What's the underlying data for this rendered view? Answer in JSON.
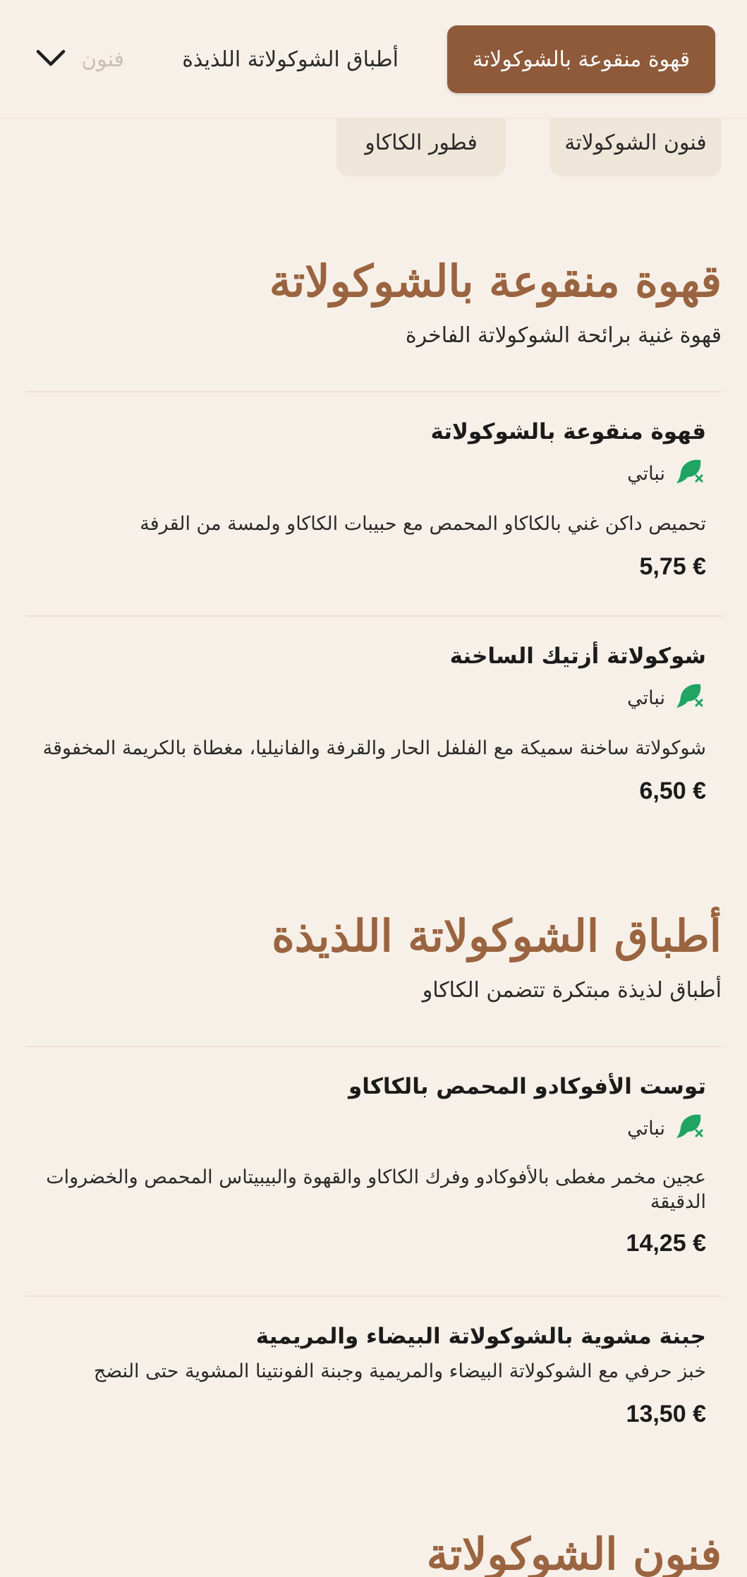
{
  "nav": {
    "tabs": [
      {
        "label": "قهوة منقوعة بالشوكولاتة",
        "active": true
      },
      {
        "label": "أطباق الشوكولاتة اللذيذة",
        "active": false
      },
      {
        "label": "فنون",
        "active": false
      }
    ],
    "more_icon": "chevron-down-icon"
  },
  "chips": [
    {
      "label": "فنون الشوكولاتة"
    },
    {
      "label": "فطور الكاكاو"
    }
  ],
  "sections": [
    {
      "title": "قهوة منقوعة بالشوكولاتة",
      "subtitle": "قهوة غنية برائحة الشوكولاتة الفاخرة",
      "items": [
        {
          "name": "قهوة منقوعة بالشوكولاتة",
          "diet_label": "نباتي",
          "diet_icon": "vegan-leaf-icon",
          "description": "تحميص داكن غني بالكاكاو المحمص مع حبيبات الكاكاو ولمسة من القرفة",
          "price": "5,75 €"
        },
        {
          "name": "شوكولاتة أزتيك الساخنة",
          "diet_label": "نباتي",
          "diet_icon": "vegan-leaf-icon",
          "description": "شوكولاتة ساخنة سميكة مع الفلفل الحار والقرفة والفانيليا، مغطاة بالكريمة المخفوقة",
          "price": "6,50 €"
        }
      ]
    },
    {
      "title": "أطباق الشوكولاتة اللذيذة",
      "subtitle": "أطباق لذيذة مبتكرة تتضمن الكاكاو",
      "items": [
        {
          "name": "توست الأفوكادو المحمص بالكاكاو",
          "diet_label": "نباتي",
          "diet_icon": "vegan-leaf-icon",
          "description": "عجين مخمر مغطى بالأفوكادو وفرك الكاكاو والقهوة والبيبيتاس المحمص والخضروات الدقيقة",
          "price": "14,25 €"
        },
        {
          "name": "جبنة مشوية بالشوكولاتة البيضاء والمريمية",
          "description": "خبز حرفي مع الشوكولاتة البيضاء والمريمية وجبنة الفونتينا المشوية حتى النضج",
          "price": "13,50 €"
        }
      ]
    },
    {
      "title": "فنون الشوكولاتة"
    }
  ],
  "colors": {
    "background": "#f7f0e8",
    "accent": "#8e5a3a",
    "title": "#9a6440",
    "vegan_icon": "#1fa463"
  }
}
